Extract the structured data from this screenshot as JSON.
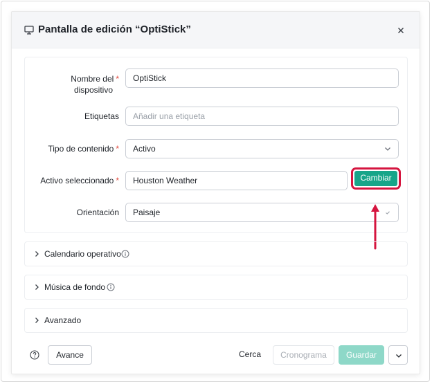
{
  "modal": {
    "title": "Pantalla de edición  “OptiStick”",
    "close_label": "×"
  },
  "form": {
    "device_name": {
      "label_line1": "Nombre del",
      "label_line2": "dispositivo",
      "required": "*",
      "value": "OptiStick"
    },
    "tags": {
      "label": "Etiquetas",
      "placeholder": "Añadir una etiqueta"
    },
    "content_type": {
      "label": "Tipo de contenido",
      "required": "*",
      "value": "Activo"
    },
    "selected_asset": {
      "label": "Activo seleccionado",
      "required": "*",
      "value": "Houston Weather",
      "change_label": "Cambiar"
    },
    "orientation": {
      "label": "Orientación",
      "value": "Paisaje"
    }
  },
  "sections": [
    {
      "label": "Calendario operativo",
      "has_info": true
    },
    {
      "label": "Música de fondo",
      "has_info": true
    },
    {
      "label": "Avanzado",
      "has_info": false
    }
  ],
  "footer": {
    "preview_label": "Avance",
    "close_label": "Cerca",
    "schedule_label": "Cronograma",
    "save_label": "Guardar"
  },
  "colors": {
    "accent": "#17a589",
    "highlight": "#d5153f",
    "required": "#e0463a"
  }
}
